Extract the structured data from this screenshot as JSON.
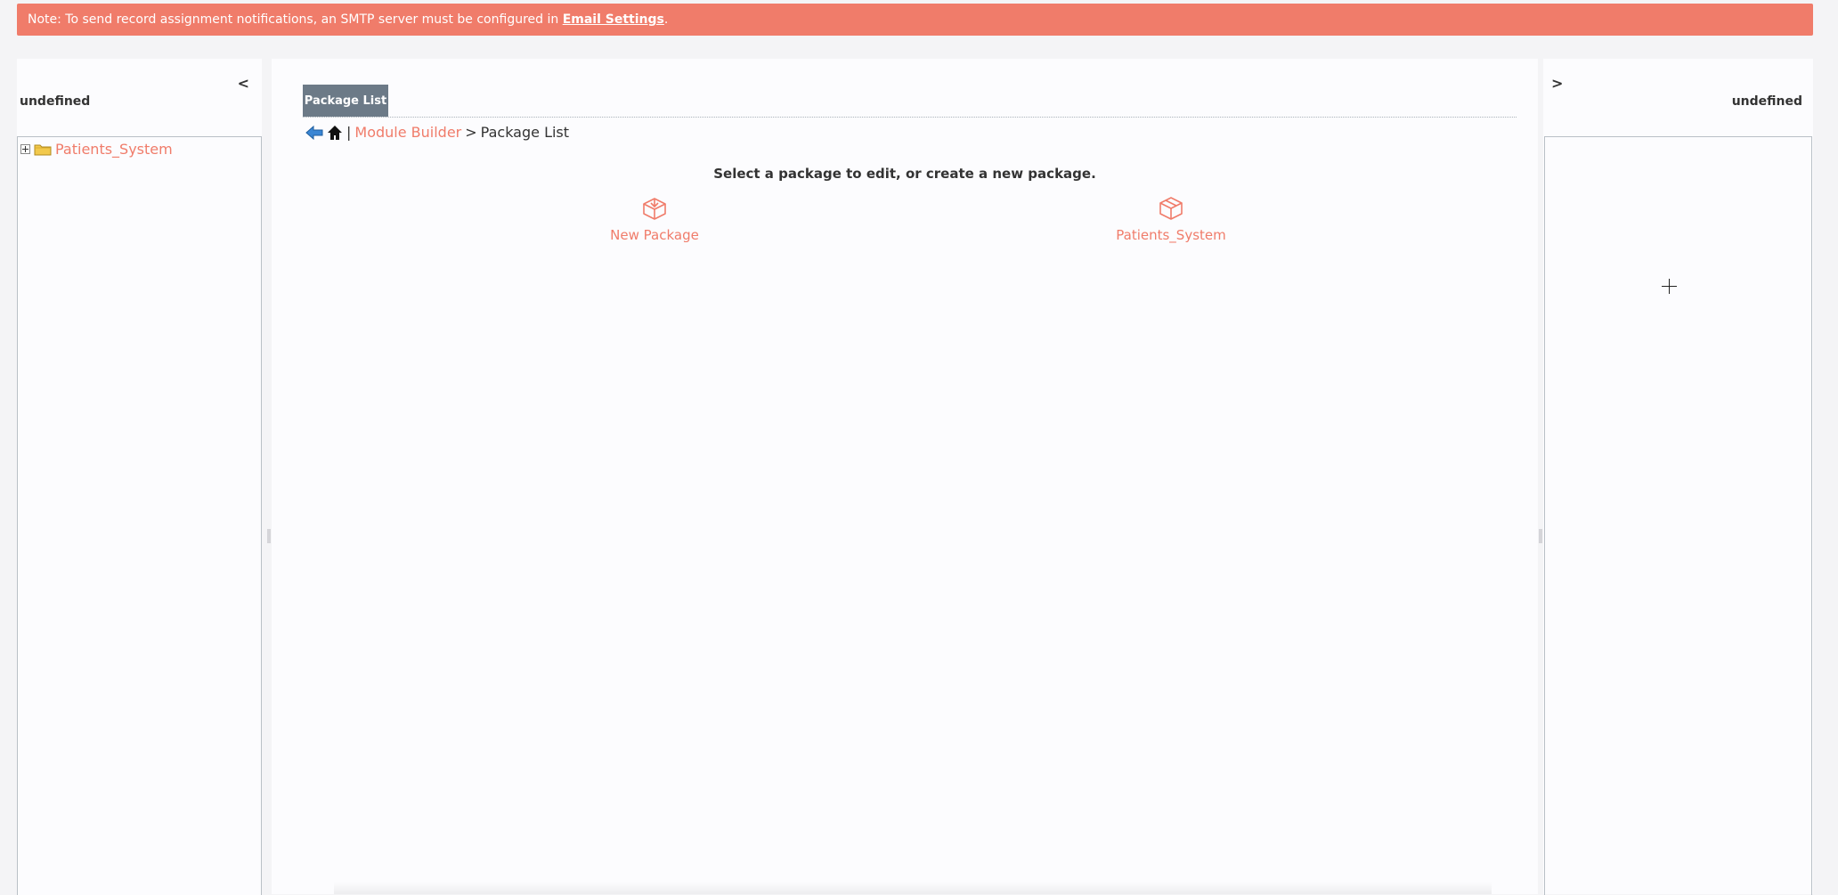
{
  "notice": {
    "text": "Note: To send record assignment notifications, an SMTP server must be configured in ",
    "link": "Email Settings",
    "suffix": ".",
    "color": "#f07c6a"
  },
  "left_panel": {
    "toggle": "<",
    "title": "undefined",
    "tree": [
      {
        "label": "Patients_System",
        "icon": "folder-icon",
        "expander": "plus-icon"
      }
    ]
  },
  "center": {
    "tab": "Package List",
    "breadcrumb": {
      "back_icon": "back-arrow-icon",
      "home_icon": "home-icon",
      "separator": "|",
      "module_builder": "Module Builder",
      "arrow": ">",
      "current": "Package List"
    },
    "instruction": "Select a package to edit, or create a new package.",
    "packages": [
      {
        "label": "New Package",
        "icon": "new-package-icon"
      },
      {
        "label": "Patients_System",
        "icon": "package-icon"
      }
    ]
  },
  "right_panel": {
    "toggle": ">",
    "title": "undefined"
  },
  "colors": {
    "accent": "#f07c6a",
    "tab": "#6c7a87",
    "border": "#b9c0c6"
  }
}
